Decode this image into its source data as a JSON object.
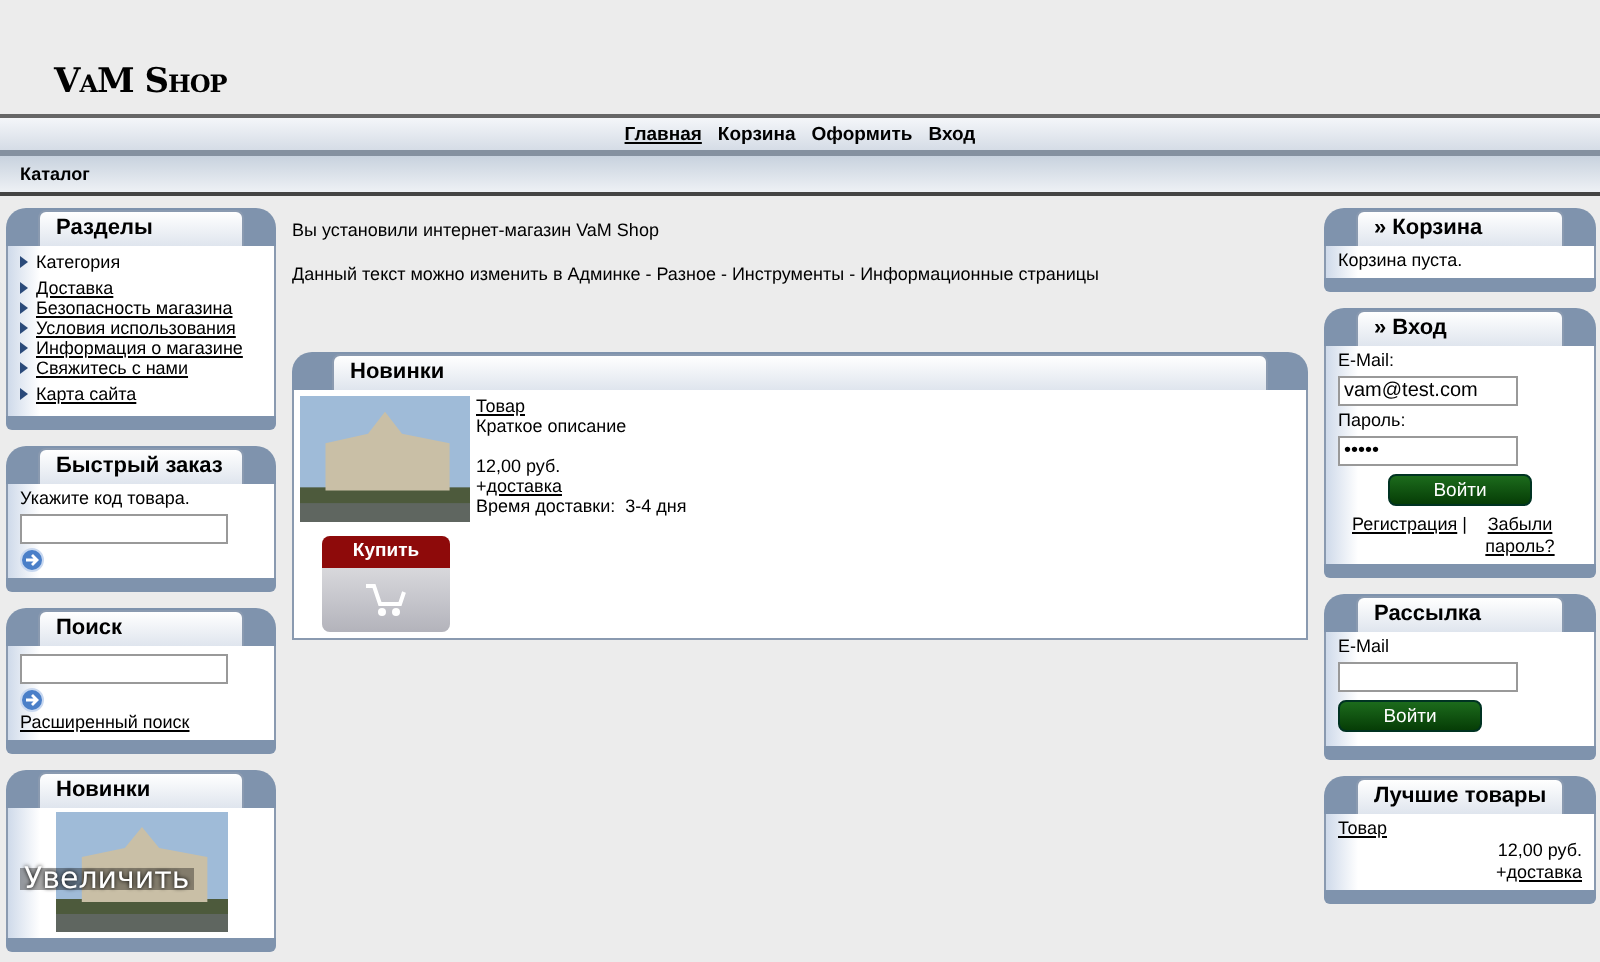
{
  "logo": "VaM Shop",
  "nav": [
    {
      "label": "Главная",
      "selected": true
    },
    {
      "label": "Корзина",
      "selected": false
    },
    {
      "label": "Оформить",
      "selected": false
    },
    {
      "label": "Вход",
      "selected": false
    }
  ],
  "breadcrumb": "Каталог",
  "left": {
    "sections": {
      "title": "Разделы",
      "groups": [
        [
          {
            "label": "Категория",
            "kind": "category"
          }
        ],
        [
          {
            "label": "Доставка",
            "kind": "link"
          },
          {
            "label": "Безопасность магазина",
            "kind": "link"
          },
          {
            "label": "Условия использования",
            "kind": "link"
          },
          {
            "label": "Информация о магазине",
            "kind": "link"
          },
          {
            "label": "Свяжитесь с нами",
            "kind": "link"
          }
        ],
        [
          {
            "label": "Карта сайта",
            "kind": "link"
          }
        ]
      ]
    },
    "quick_order": {
      "title": "Быстрый заказ",
      "hint": "Укажите код товара."
    },
    "search": {
      "title": "Поиск",
      "advanced_link": "Расширенный поиск"
    },
    "new_items": {
      "title": "Новинки",
      "zoom_caption": "Увеличить"
    }
  },
  "main": {
    "intro": [
      "Вы установили интернет-магазин VaM Shop",
      "Данный текст можно изменить в Админке - Разное - Инструменты - Информационные страницы"
    ],
    "new_products": {
      "title": "Новинки",
      "products": [
        {
          "name": "Товар",
          "description": "Краткое описание",
          "price": "12,00 руб.",
          "shipping_prefix": "+",
          "shipping_link": "доставка",
          "delivery_time": "Время доставки:  3-4 дня",
          "buy_button": "Купить"
        }
      ]
    }
  },
  "right": {
    "cart": {
      "title": "» Корзина",
      "message": "Корзина пуста."
    },
    "login": {
      "title": "» Вход",
      "email_label": "E-Mail:",
      "email_value": "vam@test.com",
      "password_label": "Пароль:",
      "password_value": "•••••",
      "submit": "Войти",
      "register_link": "Регистрация",
      "separator": "|",
      "forgot_link": "Забыли пароль?"
    },
    "newsletter": {
      "title": "Рассылка",
      "email_label": "E-Mail",
      "submit": "Войти"
    },
    "bestsellers": {
      "title": "Лучшие товары",
      "items": [
        {
          "name": "Товар",
          "price": "12,00 руб.",
          "shipping_prefix": "+",
          "shipping_link": "доставка"
        }
      ]
    }
  }
}
